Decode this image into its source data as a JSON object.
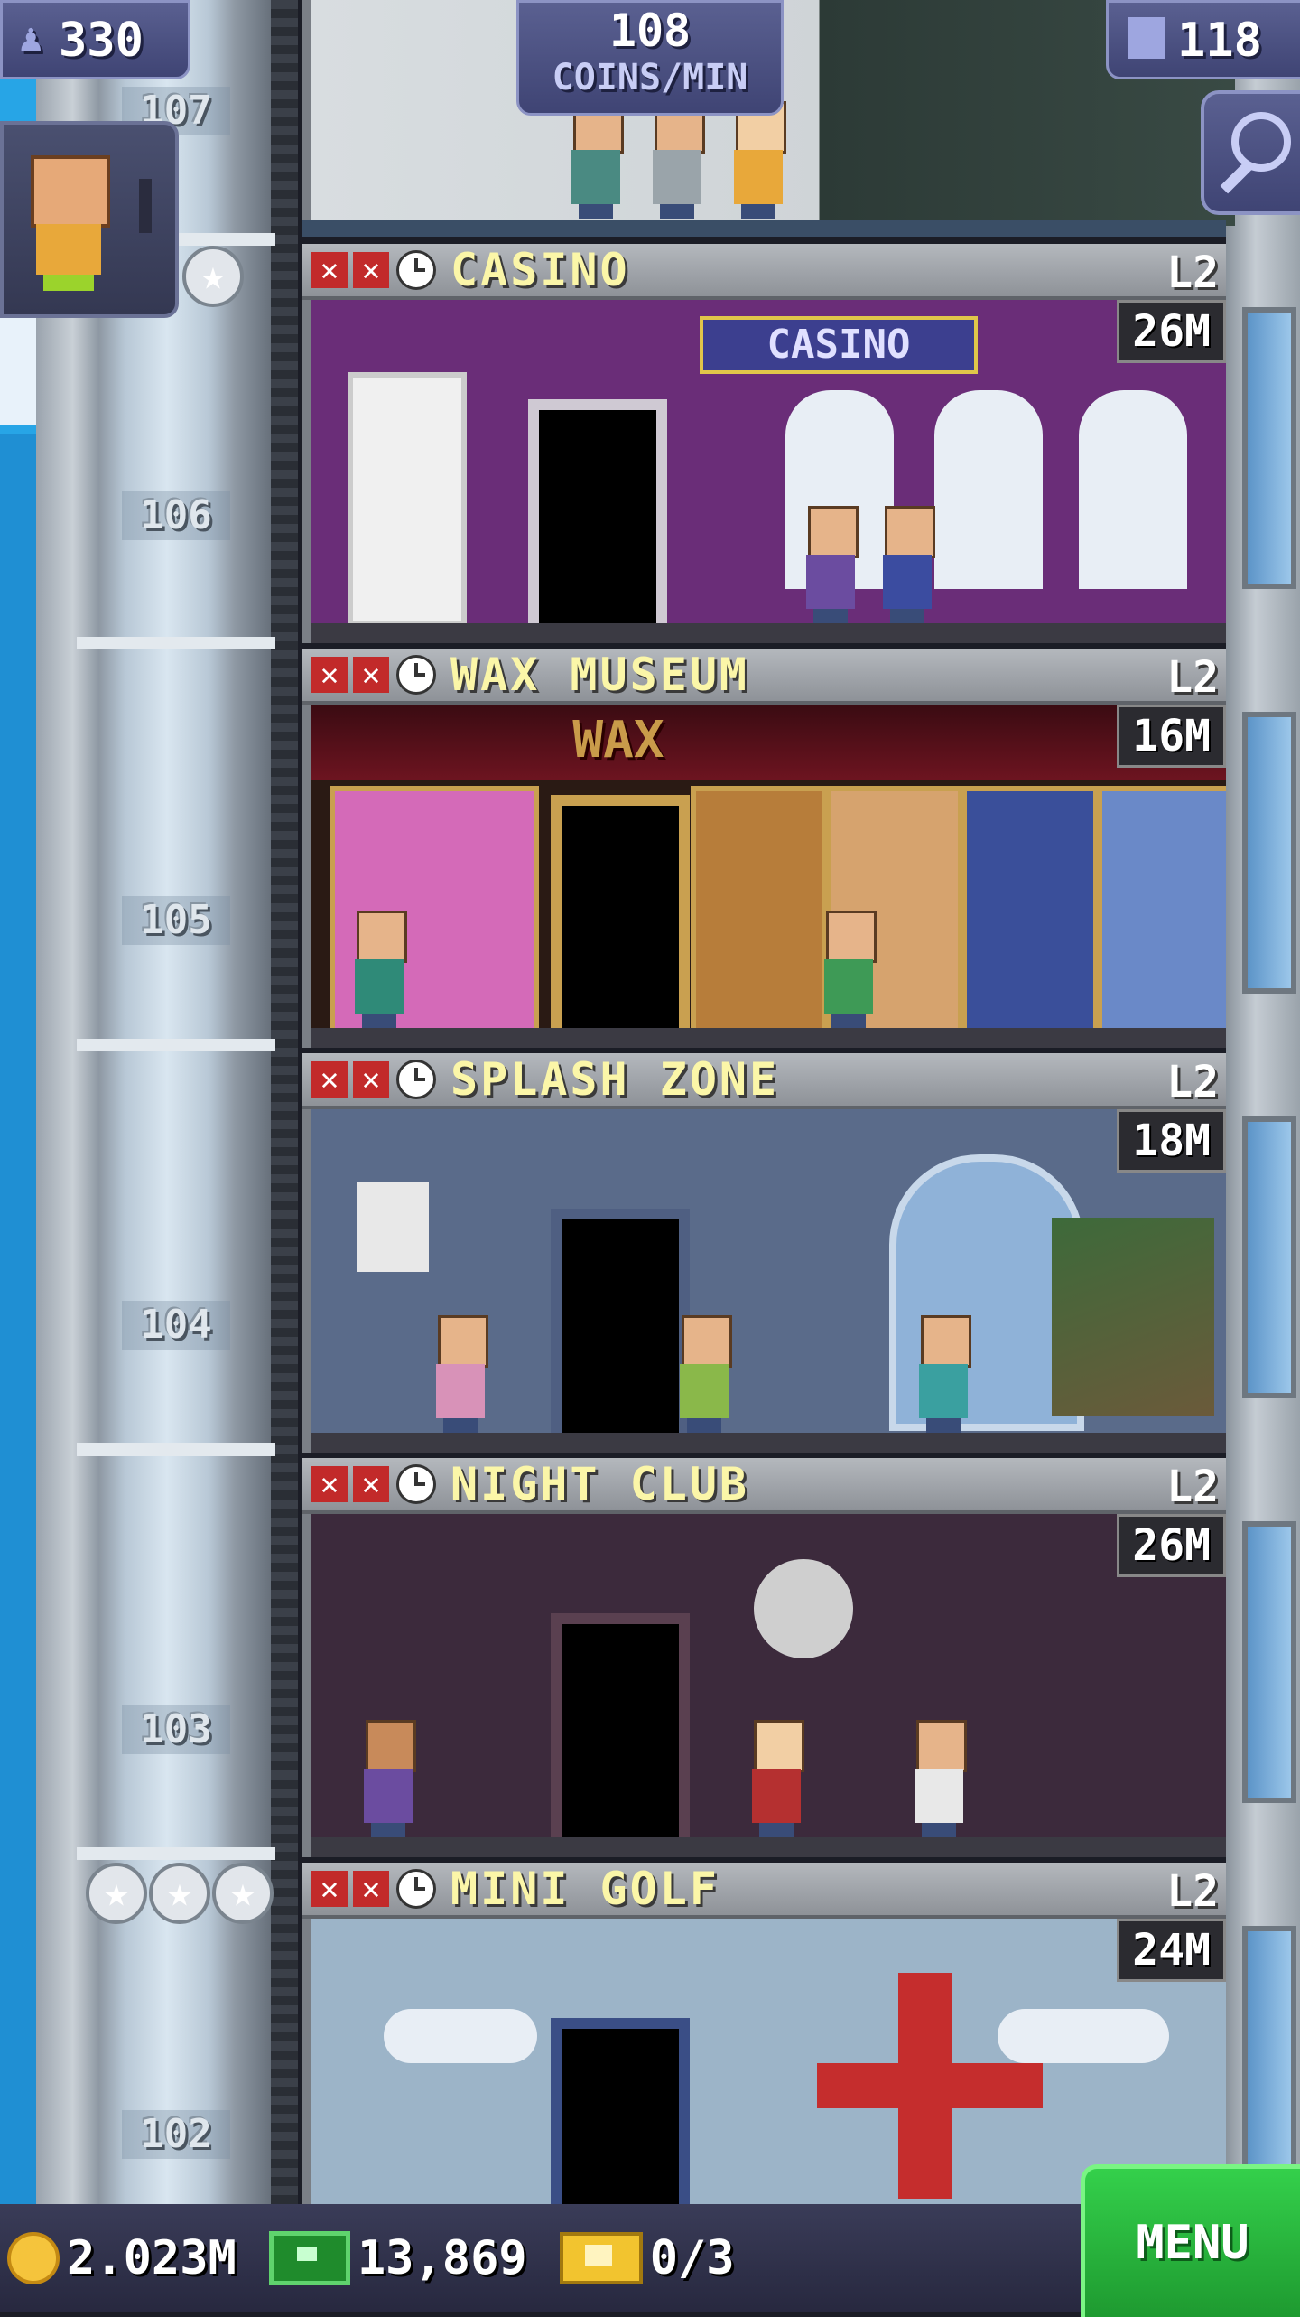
{
  "top_bar": {
    "population": "330",
    "coins_per_min_value": "108",
    "coins_per_min_label": "COINS/MIN",
    "floor_count": "118"
  },
  "floors": [
    {
      "number": "107"
    },
    {
      "number": "106",
      "name": "CASINO",
      "level": "L2",
      "price": "26M"
    },
    {
      "number": "105",
      "name": "WAX MUSEUM",
      "level": "L2",
      "price": "16M",
      "sign": "WAX"
    },
    {
      "number": "104",
      "name": "SPLASH ZONE",
      "level": "L2",
      "price": "18M"
    },
    {
      "number": "103",
      "name": "NIGHT CLUB",
      "level": "L2",
      "price": "26M"
    },
    {
      "number": "102",
      "name": "MINI GOLF",
      "level": "L2",
      "price": "24M"
    }
  ],
  "casino_sign": "CASINO",
  "bottom_bar": {
    "coins": "2.023M",
    "bux": "13,869",
    "tickets": "0/3",
    "menu_label": "MENU"
  },
  "colors": {
    "sky": "#27a5e6",
    "bar_bg": "#27283f",
    "menu_green": "#2bb53e",
    "floor_title": "#fbf6a8",
    "status_red": "#c22a2a"
  }
}
